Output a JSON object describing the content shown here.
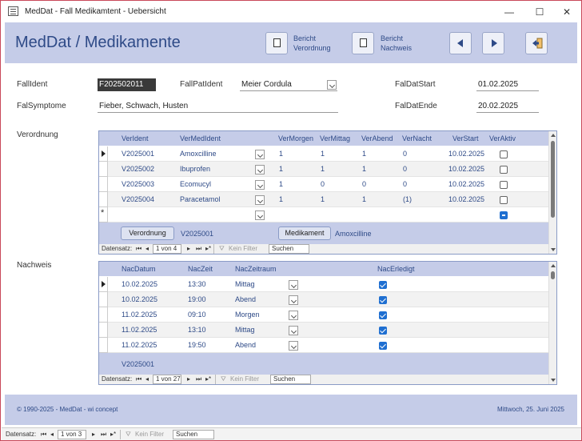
{
  "window": {
    "title": "MedDat - Fall Medikamtent - Uebersicht",
    "minimize": "—",
    "maximize": "☐",
    "close": "✕"
  },
  "header": {
    "title": "MedDat / Medikamente",
    "btn_verordnung_line1": "Bericht",
    "btn_verordnung_line2": "Verordnung",
    "btn_nachweis_line1": "Bericht",
    "btn_nachweis_line2": "Nachweis",
    "icons": [
      "document-icon",
      "document-icon",
      "arrow-left-icon",
      "arrow-right-icon",
      "exit-icon"
    ]
  },
  "form": {
    "fallid_label": "FallIdent",
    "fallid_value": "F202502011",
    "fallpat_label": "FallPatIdent",
    "fallpat_value": "Meier Cordula",
    "faldatstart_label": "FalDatStart",
    "faldatstart_value": "01.02.2025",
    "symptome_label": "FalSymptome",
    "symptome_value": "Fieber, Schwach, Husten",
    "faldatende_label": "FalDatEnde",
    "faldatende_value": "20.02.2025",
    "verordnung_label": "Verordnung",
    "nachweis_label": "Nachweis"
  },
  "verordnung": {
    "columns": [
      "VerIdent",
      "VerMedIdent",
      "VerMorgen",
      "VerMittag",
      "VerAbend",
      "VerNacht",
      "VerStart",
      "VerAktiv"
    ],
    "rows": [
      {
        "id": "V2025001",
        "med": "Amoxcilline",
        "morgen": "1",
        "mittag": "1",
        "abend": "1",
        "nacht": "0",
        "start": "10.02.2025",
        "aktiv": false
      },
      {
        "id": "V2025002",
        "med": "Ibuprofen",
        "morgen": "1",
        "mittag": "1",
        "abend": "1",
        "nacht": "0",
        "start": "10.02.2025",
        "aktiv": false
      },
      {
        "id": "V2025003",
        "med": "Ecomucyl",
        "morgen": "1",
        "mittag": "0",
        "abend": "0",
        "nacht": "0",
        "start": "10.02.2025",
        "aktiv": false
      },
      {
        "id": "V2025004",
        "med": "Paracetamol",
        "morgen": "1",
        "mittag": "1",
        "abend": "1",
        "nacht": "(1)",
        "start": "10.02.2025",
        "aktiv": false
      }
    ],
    "btn_verordnung": "Verordnung",
    "footer_id": "V2025001",
    "btn_medikament": "Medikament",
    "footer_med": "Amoxcilline",
    "nav_label": "Datensatz:",
    "nav_pos": "1 von 4",
    "nav_filter": "Kein Filter",
    "nav_search": "Suchen"
  },
  "nachweis": {
    "columns": [
      "NacDatum",
      "NacZeit",
      "NacZeitraum",
      "NacErledigt"
    ],
    "rows": [
      {
        "datum": "10.02.2025",
        "zeit": "13:30",
        "raum": "Mittag",
        "erledigt": true
      },
      {
        "datum": "10.02.2025",
        "zeit": "19:00",
        "raum": "Abend",
        "erledigt": true
      },
      {
        "datum": "11.02.2025",
        "zeit": "09:10",
        "raum": "Morgen",
        "erledigt": true
      },
      {
        "datum": "11.02.2025",
        "zeit": "13:10",
        "raum": "Mittag",
        "erledigt": true
      },
      {
        "datum": "11.02.2025",
        "zeit": "19:50",
        "raum": "Abend",
        "erledigt": true
      }
    ],
    "footer_id": "V2025001",
    "nav_label": "Datensatz:",
    "nav_pos": "1 von 27",
    "nav_filter": "Kein Filter",
    "nav_search": "Suchen"
  },
  "footer": {
    "copyright": "© 1990-2025 - MedDat - wi concept",
    "date": "Mittwoch, 25. Juni 2025"
  },
  "statusbar": {
    "nav_label": "Datensatz:",
    "nav_pos": "1 von 3",
    "nav_filter": "Kein Filter",
    "nav_search": "Suchen"
  },
  "colors": {
    "accent": "#2e4a87",
    "band": "#c5cce8",
    "border": "#c9495a",
    "check": "#1f6fd1"
  }
}
